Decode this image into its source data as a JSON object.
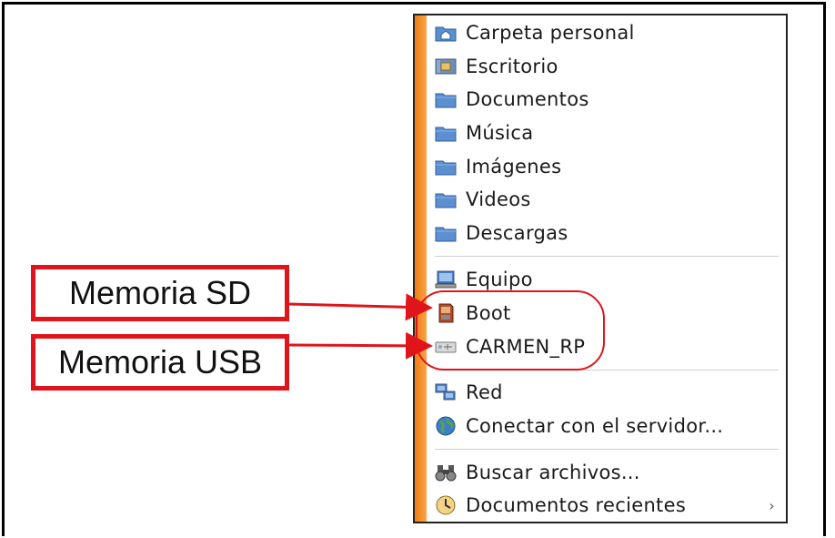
{
  "menu": {
    "items": [
      {
        "label": "Carpeta personal",
        "icon": "home-folder-icon"
      },
      {
        "label": "Escritorio",
        "icon": "desktop-icon"
      },
      {
        "label": "Documentos",
        "icon": "folder-icon"
      },
      {
        "label": "Música",
        "icon": "folder-icon"
      },
      {
        "label": "Imágenes",
        "icon": "folder-icon"
      },
      {
        "label": "Videos",
        "icon": "folder-icon"
      },
      {
        "label": "Descargas",
        "icon": "folder-icon"
      },
      {
        "label": "Equipo",
        "icon": "computer-icon"
      },
      {
        "label": "Boot",
        "icon": "sd-card-icon"
      },
      {
        "label": "CARMEN_RP",
        "icon": "usb-drive-icon"
      },
      {
        "label": "Red",
        "icon": "network-icon"
      },
      {
        "label": "Conectar con el servidor...",
        "icon": "globe-icon"
      },
      {
        "label": "Buscar archivos...",
        "icon": "search-binoculars-icon"
      },
      {
        "label": "Documentos recientes",
        "icon": "recent-documents-icon",
        "submenu_indicator": "›"
      }
    ]
  },
  "annotations": {
    "sd_label": "Memoria SD",
    "usb_label": "Memoria USB"
  },
  "colors": {
    "accent_stripe": "#f07c10",
    "callout_red": "#e0141b",
    "folder_blue": "#5b8fd0"
  }
}
